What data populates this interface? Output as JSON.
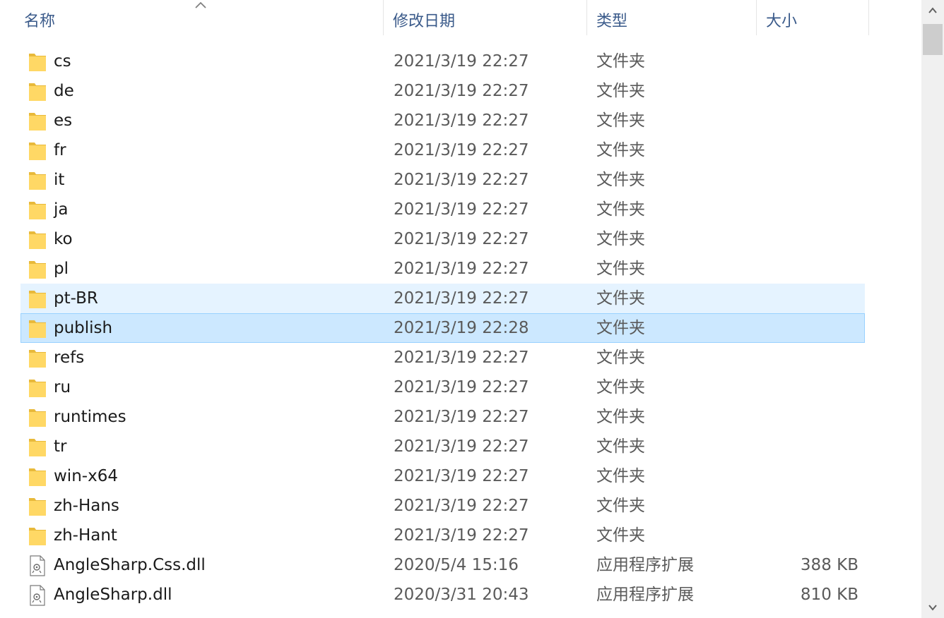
{
  "columns": {
    "name": "名称",
    "modified": "修改日期",
    "type": "类型",
    "size": "大小"
  },
  "files": [
    {
      "name": "cs",
      "modified": "2021/3/19 22:27",
      "type": "文件夹",
      "size": "",
      "icon": "folder-icon",
      "state": "normal"
    },
    {
      "name": "de",
      "modified": "2021/3/19 22:27",
      "type": "文件夹",
      "size": "",
      "icon": "folder-icon",
      "state": "normal"
    },
    {
      "name": "es",
      "modified": "2021/3/19 22:27",
      "type": "文件夹",
      "size": "",
      "icon": "folder-icon",
      "state": "normal"
    },
    {
      "name": "fr",
      "modified": "2021/3/19 22:27",
      "type": "文件夹",
      "size": "",
      "icon": "folder-icon",
      "state": "normal"
    },
    {
      "name": "it",
      "modified": "2021/3/19 22:27",
      "type": "文件夹",
      "size": "",
      "icon": "folder-icon",
      "state": "normal"
    },
    {
      "name": "ja",
      "modified": "2021/3/19 22:27",
      "type": "文件夹",
      "size": "",
      "icon": "folder-icon",
      "state": "normal"
    },
    {
      "name": "ko",
      "modified": "2021/3/19 22:27",
      "type": "文件夹",
      "size": "",
      "icon": "folder-icon",
      "state": "normal"
    },
    {
      "name": "pl",
      "modified": "2021/3/19 22:27",
      "type": "文件夹",
      "size": "",
      "icon": "folder-icon",
      "state": "normal"
    },
    {
      "name": "pt-BR",
      "modified": "2021/3/19 22:27",
      "type": "文件夹",
      "size": "",
      "icon": "folder-icon",
      "state": "hover"
    },
    {
      "name": "publish",
      "modified": "2021/3/19 22:28",
      "type": "文件夹",
      "size": "",
      "icon": "folder-icon",
      "state": "selected"
    },
    {
      "name": "refs",
      "modified": "2021/3/19 22:27",
      "type": "文件夹",
      "size": "",
      "icon": "folder-icon",
      "state": "normal"
    },
    {
      "name": "ru",
      "modified": "2021/3/19 22:27",
      "type": "文件夹",
      "size": "",
      "icon": "folder-icon",
      "state": "normal"
    },
    {
      "name": "runtimes",
      "modified": "2021/3/19 22:27",
      "type": "文件夹",
      "size": "",
      "icon": "folder-icon",
      "state": "normal"
    },
    {
      "name": "tr",
      "modified": "2021/3/19 22:27",
      "type": "文件夹",
      "size": "",
      "icon": "folder-icon",
      "state": "normal"
    },
    {
      "name": "win-x64",
      "modified": "2021/3/19 22:27",
      "type": "文件夹",
      "size": "",
      "icon": "folder-icon",
      "state": "normal"
    },
    {
      "name": "zh-Hans",
      "modified": "2021/3/19 22:27",
      "type": "文件夹",
      "size": "",
      "icon": "folder-icon",
      "state": "normal"
    },
    {
      "name": "zh-Hant",
      "modified": "2021/3/19 22:27",
      "type": "文件夹",
      "size": "",
      "icon": "folder-icon",
      "state": "normal"
    },
    {
      "name": "AngleSharp.Css.dll",
      "modified": "2020/5/4 15:16",
      "type": "应用程序扩展",
      "size": "388 KB",
      "icon": "dll-file-icon",
      "state": "normal"
    },
    {
      "name": "AngleSharp.dll",
      "modified": "2020/3/31 20:43",
      "type": "应用程序扩展",
      "size": "810 KB",
      "icon": "dll-file-icon",
      "state": "normal"
    }
  ],
  "colors": {
    "folder": "#ffd865",
    "folder_dark": "#e8b93a",
    "header_text": "#3a5a8a",
    "hover_bg": "#e5f3ff",
    "selected_bg": "#cce8ff",
    "selected_border": "#99d1ff"
  }
}
